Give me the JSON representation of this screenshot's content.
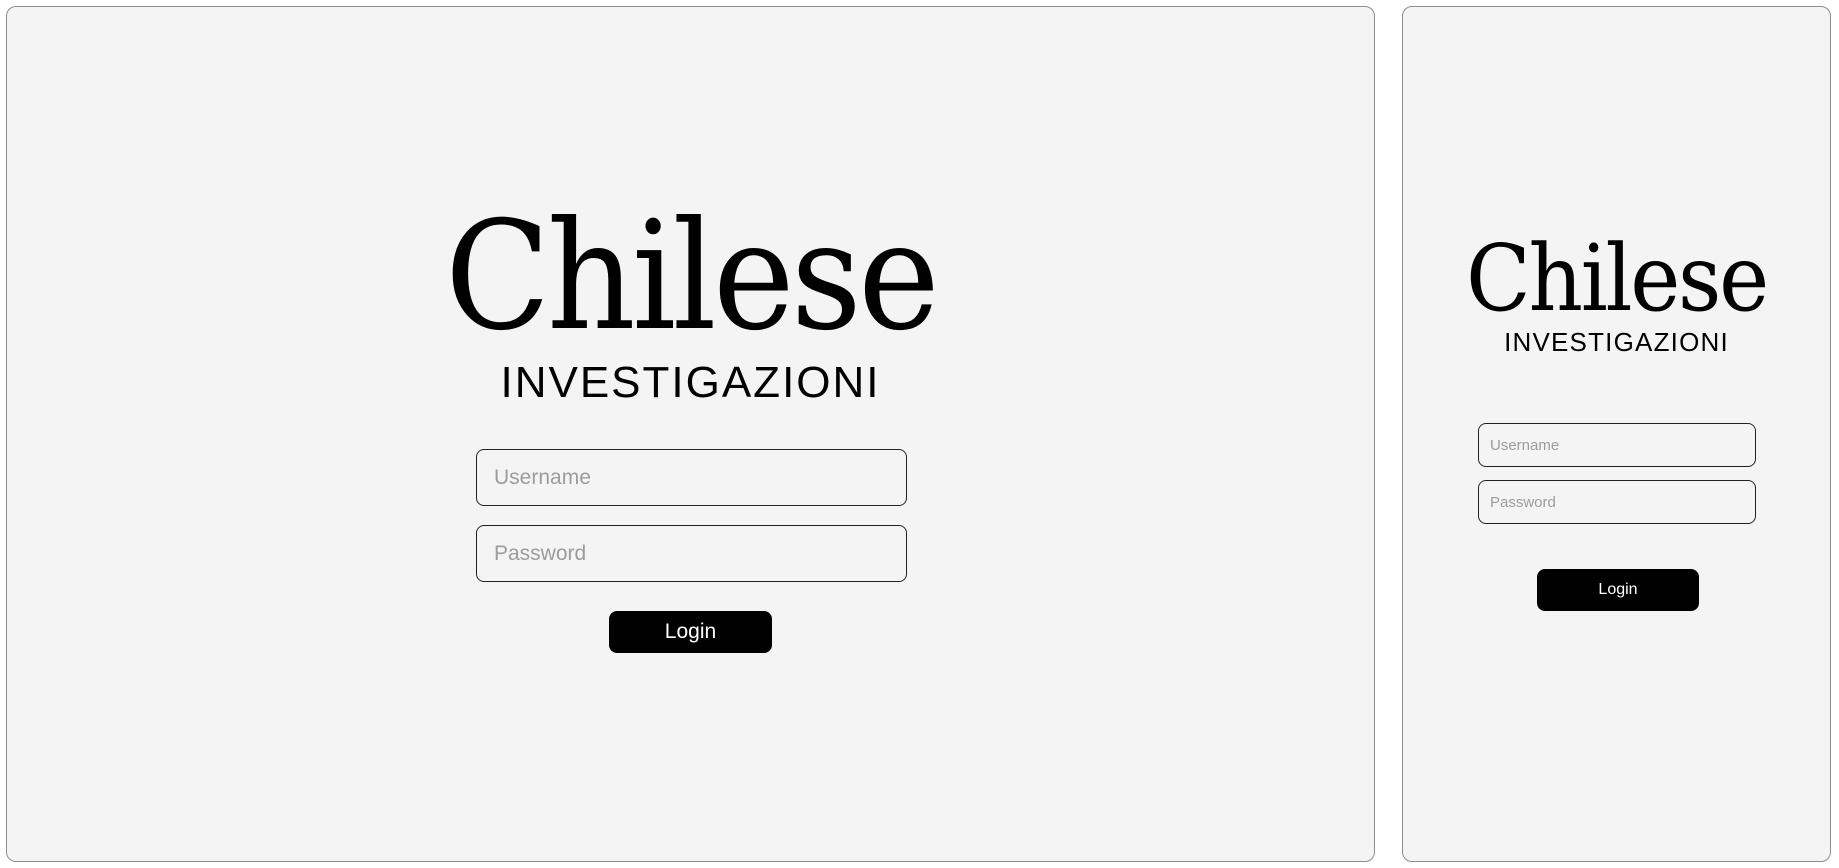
{
  "brand": {
    "title": "Chilese",
    "subtitle": "INVESTIGAZIONI"
  },
  "login_form": {
    "username_placeholder": "Username",
    "password_placeholder": "Password",
    "login_label": "Login"
  },
  "colors": {
    "background": "#f4f4f4",
    "text": "#000000",
    "button_background": "#000000",
    "button_text": "#ffffff",
    "placeholder": "#9c9c9c",
    "border": "#222222"
  }
}
